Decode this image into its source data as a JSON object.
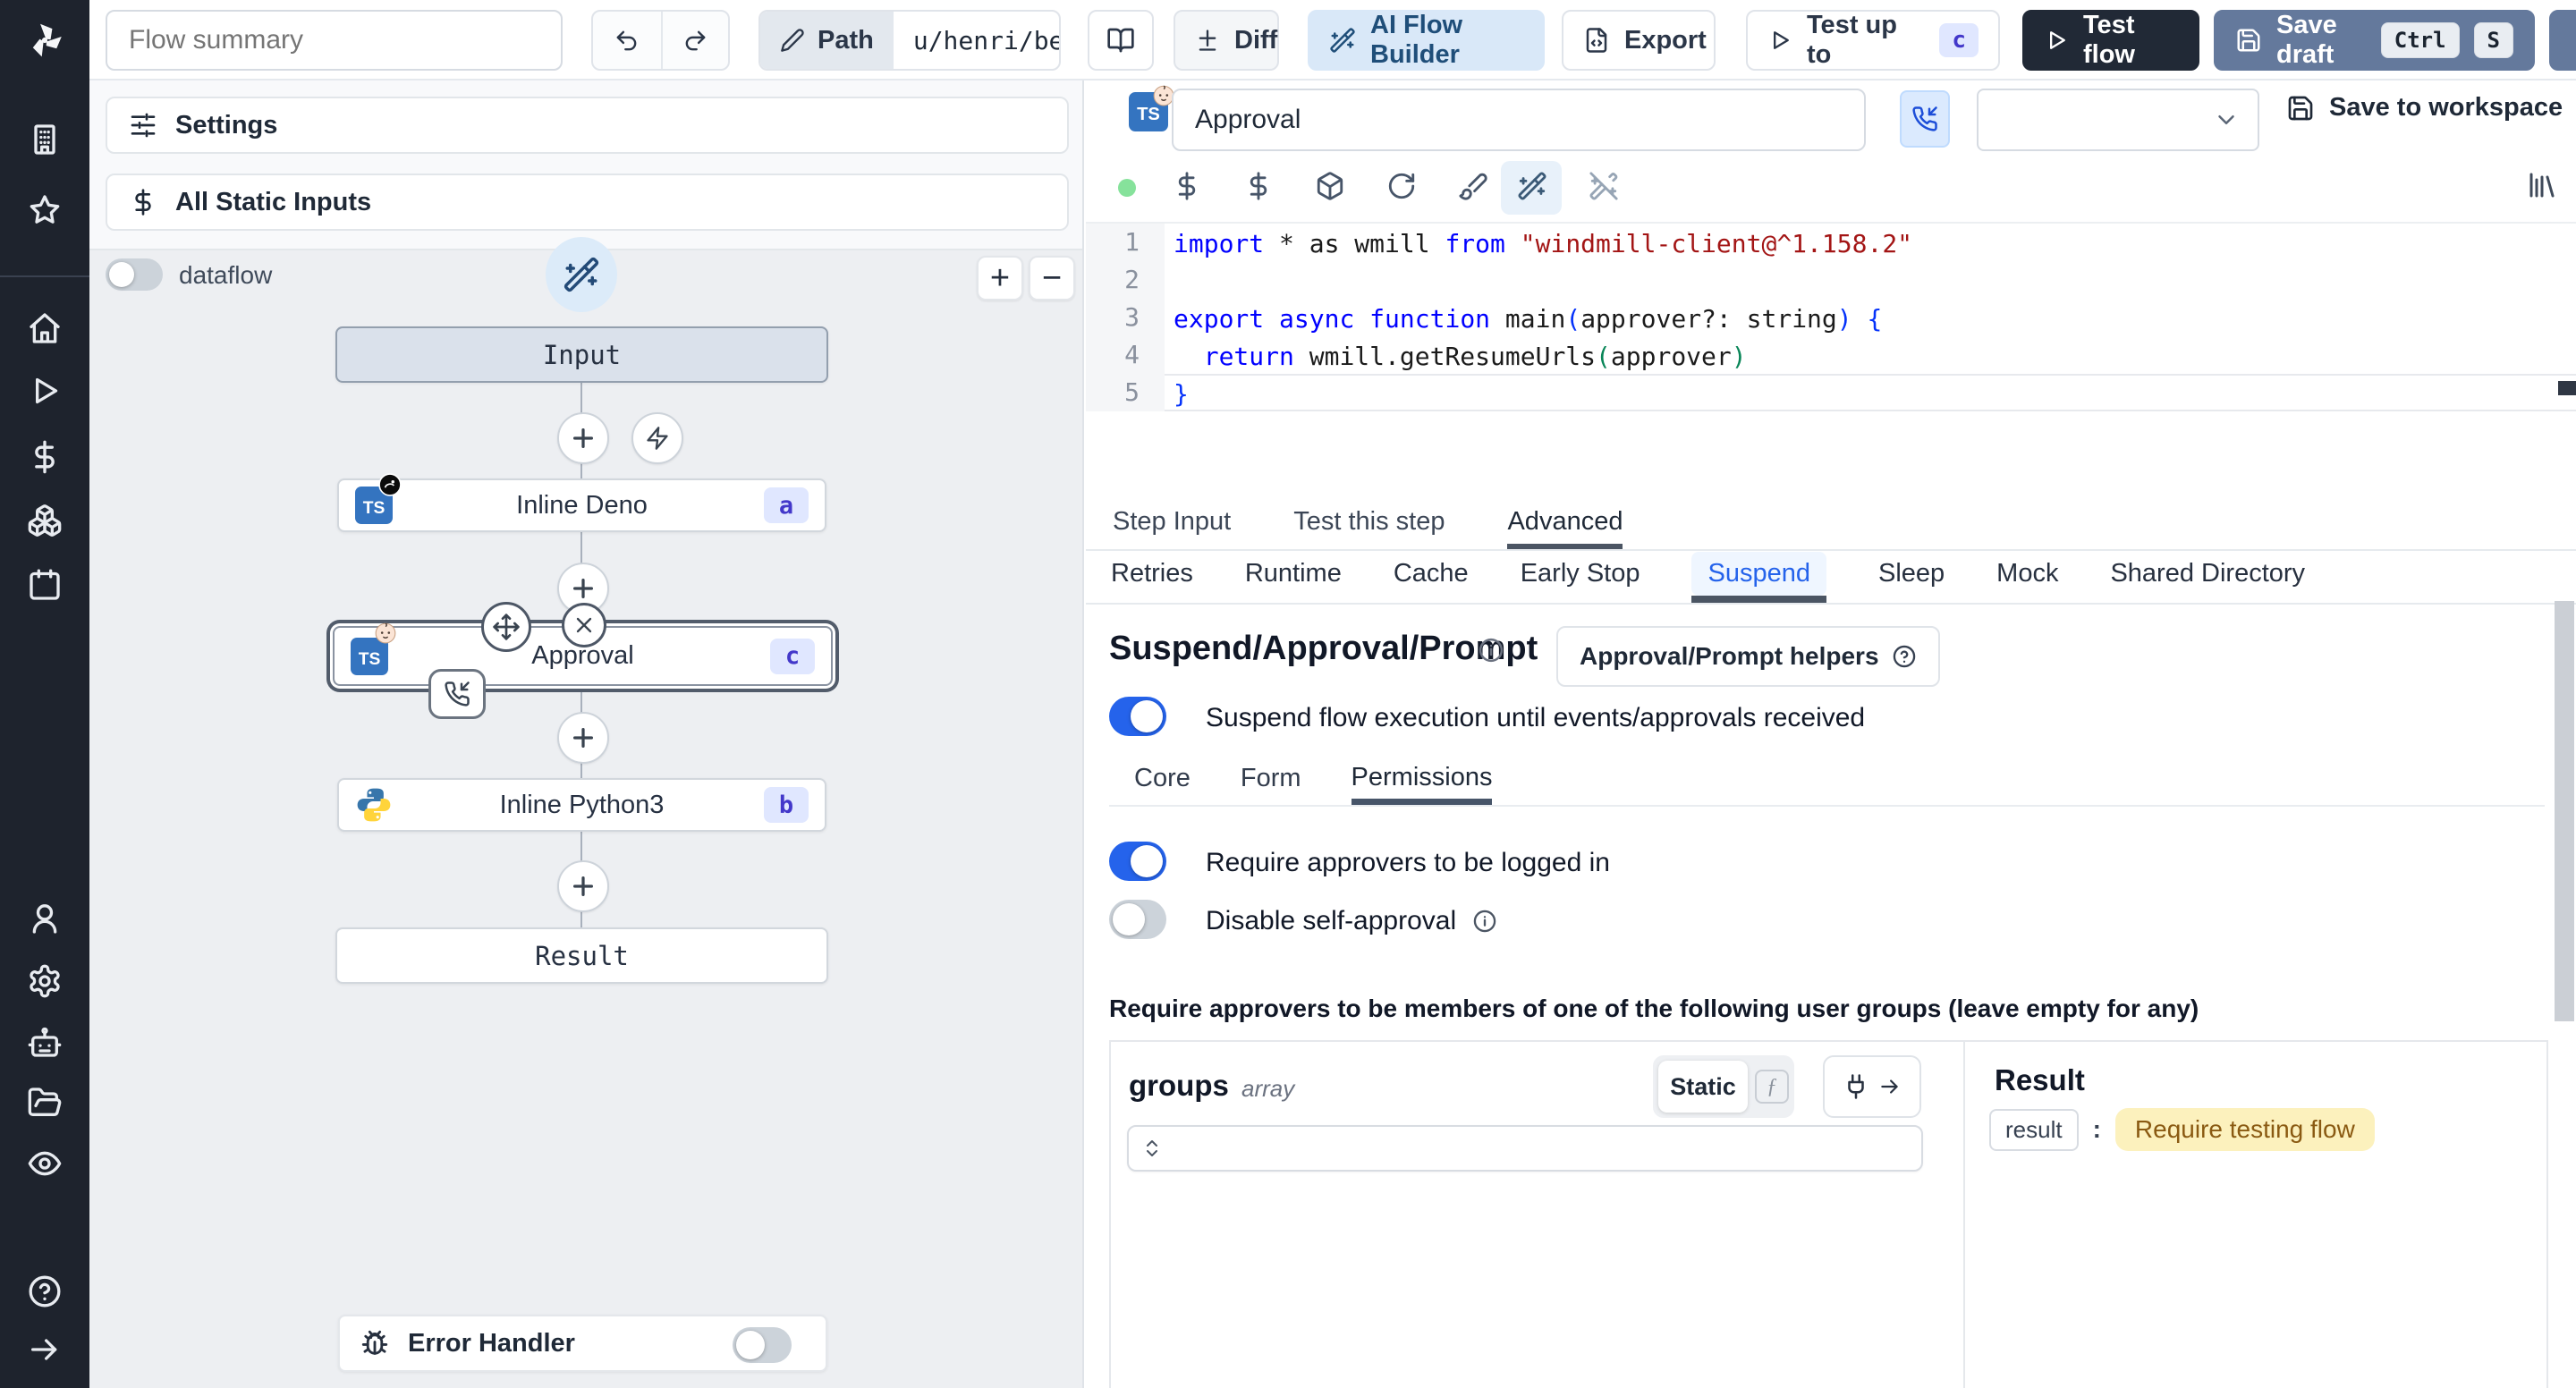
{
  "topbar": {
    "summary_placeholder": "Flow summary",
    "path_label": "Path",
    "path_value": "u/henri/bes",
    "diff_label": "Diff",
    "ai_label": "AI Flow Builder",
    "export_label": "Export",
    "test_up_to_label": "Test up to",
    "test_up_to_badge": "c",
    "test_flow_label": "Test flow",
    "save_draft_label": "Save draft",
    "kbd_ctrl": "Ctrl",
    "kbd_s": "S"
  },
  "left": {
    "settings_label": "Settings",
    "static_inputs_label": "All Static Inputs",
    "dataflow_label": "dataflow",
    "zoom_in": "+",
    "zoom_out": "−",
    "error_handler_label": "Error Handler"
  },
  "graph": {
    "input_label": "Input",
    "nodes": [
      {
        "label": "Inline Deno",
        "badge": "a"
      },
      {
        "label": "Approval",
        "badge": "c"
      },
      {
        "label": "Inline Python3",
        "badge": "b"
      }
    ],
    "result_label": "Result"
  },
  "step": {
    "name_value": "Approval",
    "save_to_workspace_label": "Save to workspace",
    "tabs": [
      "Step Input",
      "Test this step",
      "Advanced"
    ],
    "subtabs": [
      "Retries",
      "Runtime",
      "Cache",
      "Early Stop",
      "Suspend",
      "Sleep",
      "Mock",
      "Shared Directory"
    ]
  },
  "suspend": {
    "heading": "Suspend/Approval/Prompt",
    "helpers_label": "Approval/Prompt helpers",
    "suspend_toggle_label": "Suspend flow execution until events/approvals received",
    "tabs": [
      "Core",
      "Form",
      "Permissions"
    ],
    "require_login_label": "Require approvers to be logged in",
    "disable_self_label": "Disable self-approval",
    "groups_note": "Require approvers to be members of one of the following user groups (leave empty for any)",
    "groups_field": {
      "name": "groups",
      "type": "array",
      "mode": "Static",
      "fn_glyph": "ƒ"
    },
    "result": {
      "heading": "Result",
      "key": "result",
      "colon": ":",
      "value": "Require testing flow"
    }
  },
  "code": {
    "lines": [
      {
        "n": "1",
        "current": false,
        "tokens": [
          [
            "kw",
            "import"
          ],
          [
            "tx",
            " * as wmill "
          ],
          [
            "kw",
            "from"
          ],
          [
            "tx",
            " "
          ],
          [
            "st",
            "\"windmill-client@^1.158.2\""
          ]
        ]
      },
      {
        "n": "2",
        "current": false,
        "tokens": []
      },
      {
        "n": "3",
        "current": false,
        "tokens": [
          [
            "kw",
            "export"
          ],
          [
            "tx",
            " "
          ],
          [
            "kw",
            "async"
          ],
          [
            "tx",
            " "
          ],
          [
            "kw",
            "function"
          ],
          [
            "tx",
            " main"
          ],
          [
            "pb",
            "("
          ],
          [
            "tx",
            "approver?: string"
          ],
          [
            "pb",
            ")"
          ],
          [
            "tx",
            " "
          ],
          [
            "pb",
            "{"
          ]
        ]
      },
      {
        "n": "4",
        "current": false,
        "tokens": [
          [
            "tx",
            "  "
          ],
          [
            "kw",
            "return"
          ],
          [
            "tx",
            " wmill.getResumeUrls"
          ],
          [
            "pg",
            "("
          ],
          [
            "tx",
            "approver"
          ],
          [
            "pg",
            ")"
          ]
        ]
      },
      {
        "n": "5",
        "current": true,
        "tokens": [
          [
            "pb",
            "}"
          ]
        ]
      }
    ]
  },
  "colors": {
    "accent": "#2563eb",
    "toggle_on": "#2563eb",
    "badge_bg": "#e0e7ff",
    "badge_text": "#4338ca",
    "ai_button_bg": "#d9e8f8",
    "test_flow_bg": "#212936",
    "save_draft_bg": "#64799c",
    "result_highlight_bg": "#fcf1bd",
    "result_highlight_text": "#8a5a12",
    "keyword": "#0000ff",
    "string": "#a31515"
  },
  "icons": [
    "windmill-logo",
    "building",
    "star",
    "home",
    "play",
    "dollar",
    "boxes",
    "calendar",
    "user",
    "gear",
    "bot",
    "folder-open",
    "eye",
    "help-circle",
    "arrow-right",
    "undo",
    "redo",
    "pencil",
    "book-open",
    "diff",
    "wand-sparkles",
    "file-export",
    "save",
    "zap",
    "plus-cross",
    "move",
    "close-x",
    "phone-incoming",
    "bug",
    "chevron-down",
    "rotate-cw",
    "paintbrush",
    "wand-off",
    "package",
    "library",
    "info",
    "plug",
    "chevrons-up-down",
    "sliders",
    "ts-lang",
    "deno",
    "baby-face",
    "python"
  ]
}
